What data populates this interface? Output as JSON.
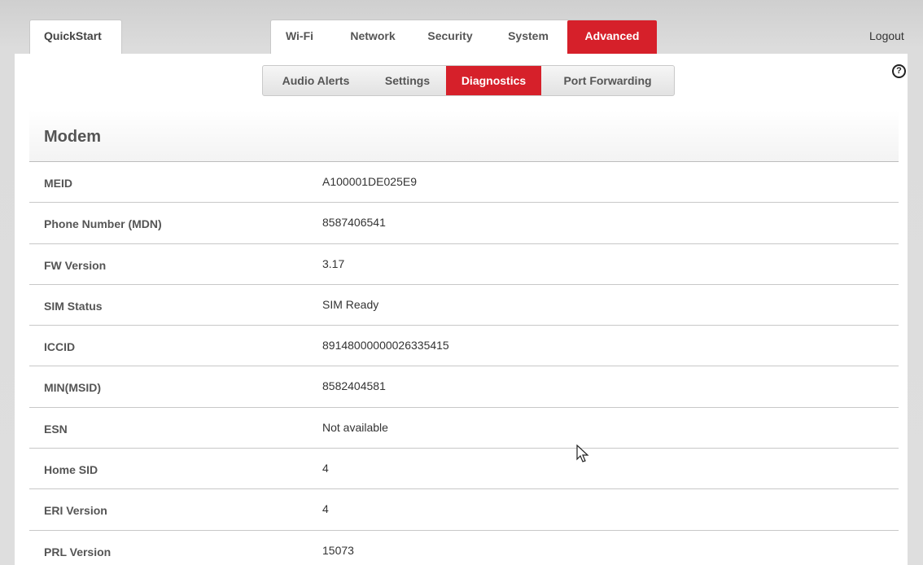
{
  "header": {
    "quickstart_label": "QuickStart",
    "tabs": [
      {
        "label": "Wi-Fi"
      },
      {
        "label": "Network"
      },
      {
        "label": "Security"
      },
      {
        "label": "System"
      },
      {
        "label": "Advanced"
      }
    ],
    "active_tab": "Advanced",
    "logout_label": "Logout"
  },
  "subnav": {
    "tabs": [
      {
        "label": "Audio Alerts"
      },
      {
        "label": "Settings"
      },
      {
        "label": "Diagnostics"
      },
      {
        "label": "Port Forwarding"
      }
    ],
    "active_tab": "Diagnostics"
  },
  "help_icon": {
    "glyph": "?",
    "icon": "help-circle-icon"
  },
  "section": {
    "title": "Modem"
  },
  "rows": [
    {
      "label": "MEID",
      "value": "A100001DE025E9"
    },
    {
      "label": "Phone Number (MDN)",
      "value": "8587406541"
    },
    {
      "label": "FW Version",
      "value": "3.17"
    },
    {
      "label": "SIM Status",
      "value": "SIM Ready"
    },
    {
      "label": "ICCID",
      "value": "89148000000026335415"
    },
    {
      "label": "MIN(MSID)",
      "value": "8582404581"
    },
    {
      "label": "ESN",
      "value": "Not available"
    },
    {
      "label": "Home SID",
      "value": "4"
    },
    {
      "label": "ERI Version",
      "value": "4"
    },
    {
      "label": "PRL Version",
      "value": "15073"
    }
  ],
  "colors": {
    "accent": "#d6202a",
    "background": "#dcdcdc",
    "panel": "#ffffff"
  }
}
